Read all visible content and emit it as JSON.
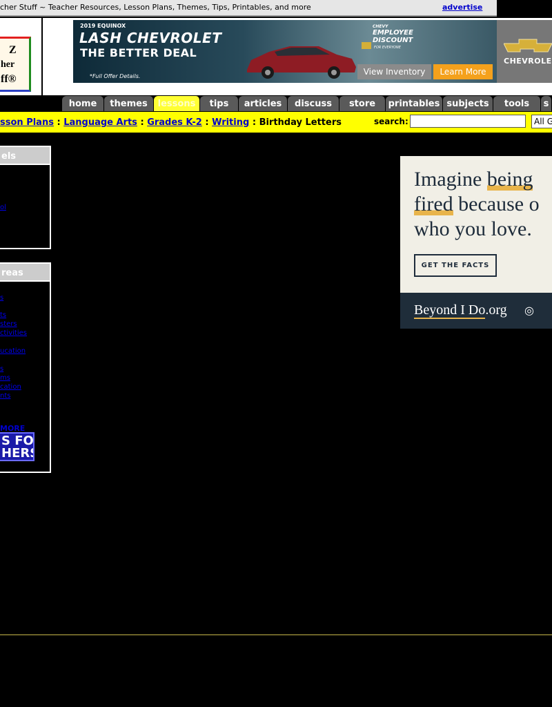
{
  "topbar": {
    "tagline": "cher Stuff ~ Teacher Resources, Lesson Plans, Themes, Tips, Printables, and more",
    "advertise": "advertise"
  },
  "logo": {
    "line1": "Z",
    "line2": "her",
    "line3": "ff®"
  },
  "banner_ad": {
    "model": "2019 EQUINOX",
    "dealer": "LASH CHEVROLET",
    "tagline": "THE BETTER DEAL",
    "fine_print": "*Full Offer Details.",
    "promo_eyebrow": "CHEVY",
    "promo": "EMPLOYEE DISCOUNT",
    "promo_sub": "FOR EVERYONE",
    "view_inventory": "View Inventory",
    "learn_more": "Learn More",
    "brand": "CHEVROLE"
  },
  "nav": {
    "tabs": [
      {
        "label": "home",
        "active": false
      },
      {
        "label": "themes",
        "active": false
      },
      {
        "label": "lessons",
        "active": true
      },
      {
        "label": "tips",
        "active": false
      },
      {
        "label": "articles",
        "active": false
      },
      {
        "label": "discuss",
        "active": false
      },
      {
        "label": "store",
        "active": false
      },
      {
        "label": "printables",
        "active": false
      },
      {
        "label": "subjects",
        "active": false
      },
      {
        "label": "tools",
        "active": false
      },
      {
        "label": "s",
        "active": false
      }
    ]
  },
  "breadcrumb": {
    "items": [
      "sson Plans",
      "Language Arts",
      "Grades K-2",
      "Writing"
    ],
    "separator": ":",
    "current": "Birthday Letters"
  },
  "search": {
    "label": "search:",
    "value": "",
    "scope": "All G"
  },
  "sidebar": {
    "levels": {
      "title": "els",
      "links": [
        "ol"
      ]
    },
    "areas": {
      "title": "reas",
      "links": [
        "s",
        "ts",
        "sters",
        "ctivities",
        "ucation",
        "s",
        "ms",
        "cation",
        "nts"
      ],
      "more": "MORE",
      "badge_line1": "S FOR",
      "badge_line2": "HERS"
    }
  },
  "right_ad": {
    "headline_line1_a": "Imagine ",
    "headline_line1_b": "being",
    "headline_line2_a": "fired",
    "headline_line2_b": " because o",
    "headline_line3": "who you love.",
    "cta": "GET THE FACTS",
    "brand_a": "Beyond I Do",
    "brand_b": ".org"
  },
  "colors": {
    "breadcrumb_bar": "#ffff00",
    "active_tab": "#ffff33",
    "tab": "#5a5a5a",
    "page_background": "#000000"
  }
}
